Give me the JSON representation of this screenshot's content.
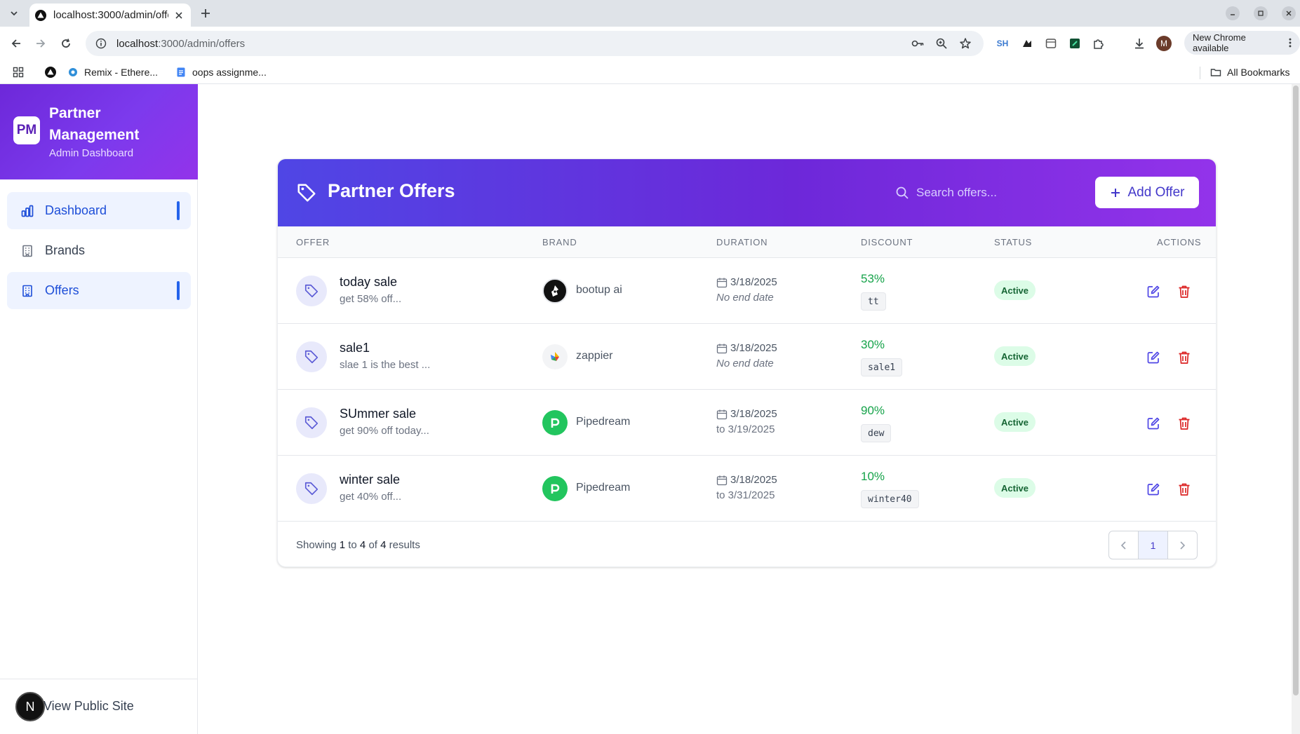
{
  "browser": {
    "tab_title": "localhost:3000/admin/offers",
    "url_host": "localhost",
    "url_rest": ":3000/admin/offers",
    "update_label": "New Chrome available",
    "profile_initial": "M",
    "ext_label": "SH",
    "bookmarks": [
      {
        "label": "Remix - Ethere..."
      },
      {
        "label": "oops assignme..."
      }
    ],
    "all_bookmarks": "All Bookmarks"
  },
  "sidebar": {
    "logo_text": "PM",
    "title": "Partner Management",
    "subtitle": "Admin Dashboard",
    "items": [
      {
        "label": "Dashboard"
      },
      {
        "label": "Brands"
      },
      {
        "label": "Offers"
      }
    ],
    "view_public": "View Public Site",
    "next_badge": "N"
  },
  "offers_card": {
    "title": "Partner Offers",
    "search_placeholder": "Search offers...",
    "add_label": "Add Offer",
    "columns": [
      "OFFER",
      "BRAND",
      "DURATION",
      "DISCOUNT",
      "STATUS",
      "ACTIONS"
    ],
    "rows": [
      {
        "name": "today sale",
        "desc": "get 58% off...",
        "brand": "bootup ai",
        "start": "3/18/2025",
        "end": "No end date",
        "discount": "53%",
        "code": "tt",
        "status": "Active"
      },
      {
        "name": "sale1",
        "desc": "slae 1 is the best ...",
        "brand": "zappier",
        "start": "3/18/2025",
        "end": "No end date",
        "discount": "30%",
        "code": "sale1",
        "status": "Active"
      },
      {
        "name": "SUmmer sale",
        "desc": "get 90% off today...",
        "brand": "Pipedream",
        "start": "3/18/2025",
        "end": "to 3/19/2025",
        "discount": "90%",
        "code": "dew",
        "status": "Active"
      },
      {
        "name": "winter sale",
        "desc": "get 40% off...",
        "brand": "Pipedream",
        "start": "3/18/2025",
        "end": "to 3/31/2025",
        "discount": "10%",
        "code": "winter40",
        "status": "Active"
      }
    ],
    "footer": {
      "showing_prefix": "Showing",
      "from": "1",
      "to_word": "to",
      "to": "4",
      "of_word": "of",
      "total": "4",
      "results_word": "results",
      "current_page": "1"
    }
  },
  "colors": {
    "accent": "#4f46e5",
    "header_gradient_end": "#9333ea",
    "discount_green": "#16a34a",
    "delete_red": "#dc2626",
    "active_nav": "#2563eb"
  }
}
